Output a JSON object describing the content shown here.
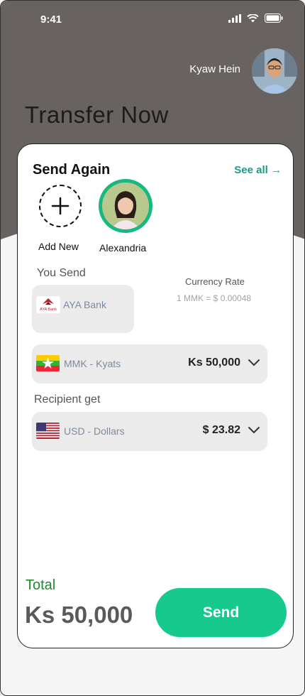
{
  "status_bar": {
    "time": "9:41"
  },
  "header": {
    "user_name": "Kyaw Hein",
    "title": "Transfer Now"
  },
  "send_again": {
    "heading": "Send Again",
    "see_all": "See all →",
    "add_new_label": "Add New",
    "contact_name": "Alexandria"
  },
  "you_send": {
    "label": "You Send",
    "bank_name": "AYA Bank",
    "bank_logo_text": "AYA Bank"
  },
  "currency_rate": {
    "label": "Currency Rate",
    "value": "1 MMK = $ 0.00048"
  },
  "send_currency": {
    "name": "MMK - Kyats",
    "amount": "Ks 50,000"
  },
  "recipient": {
    "label": "Recipient get",
    "currency_name": "USD -  Dollars",
    "amount": "$ 23.82"
  },
  "total": {
    "label": "Total",
    "amount": "Ks 50,000"
  },
  "actions": {
    "send_label": "Send"
  },
  "colors": {
    "header_bg": "#686361",
    "accent_green": "#16c98d",
    "see_all": "#1a9b89",
    "total_label": "#1d8a2b"
  }
}
